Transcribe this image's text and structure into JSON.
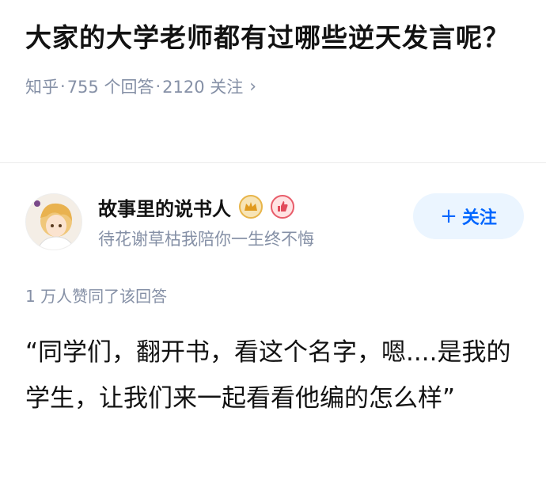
{
  "question": {
    "title": "大家的大学老师都有过哪些逆天发言呢？",
    "source": "知乎",
    "answers": "755 个回答",
    "followers": "2120 关注",
    "chevron_icon": "chevron-right-icon"
  },
  "author": {
    "name": "故事里的说书人",
    "bio": "待花谢草枯我陪你一生终不悔",
    "badges": [
      "crown-badge-icon",
      "like-badge-icon"
    ],
    "follow_label": "关注",
    "follow_plus": "+"
  },
  "answer": {
    "likes_text": "1 万人赞同了该回答",
    "content": "“同学们，翻开书，看这个名字，嗯....是我的学生，让我们来一起看看他编的怎么样”"
  },
  "colors": {
    "accent": "#0066ff",
    "follow_bg": "#ebf5ff",
    "meta_gray": "#8590a6",
    "text": "#121212"
  }
}
